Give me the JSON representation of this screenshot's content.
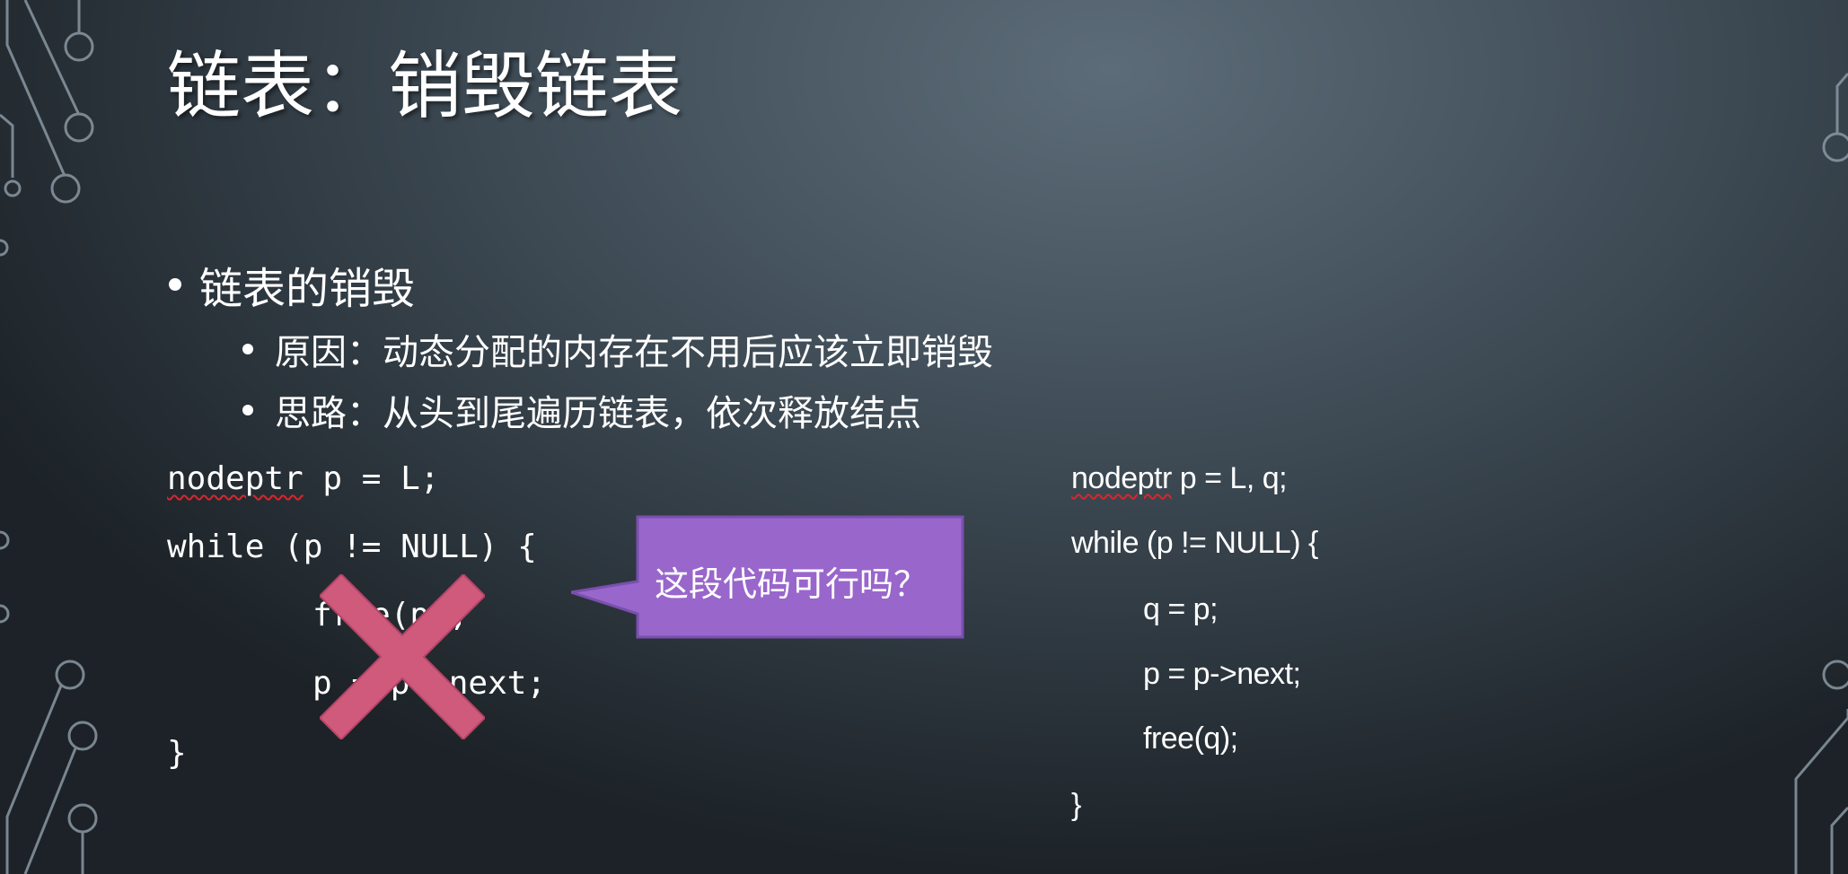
{
  "slide": {
    "title": "链表：销毁链表",
    "bullet_main": "链表的销毁",
    "sub_bullets": [
      "原因：动态分配的内存在不用后应该立即销毁",
      "思路：从头到尾遍历链表，依次释放结点"
    ]
  },
  "code_left": {
    "line1_keyword": "nodeptr",
    "line1_rest": " p = L;",
    "line2": "while (p != NULL) {",
    "line3": "free(p);",
    "line4": "p = p->next;",
    "line5": "}"
  },
  "code_right": {
    "line1_keyword": "nodeptr",
    "line1_rest": " p = L, q;",
    "line2": "while (p != NULL) {",
    "line3": "q = p;",
    "line4": "p = p->next;",
    "line5": "free(q);",
    "line6": "}"
  },
  "callout": {
    "text": "这段代码可行吗？",
    "fill": "#9966cc",
    "border": "#7a4fae"
  },
  "cross_mark": {
    "icon": "x-cross-icon",
    "color": "#d05a7c"
  },
  "colors": {
    "text": "#ffffff",
    "spellcheck": "#d8262b"
  }
}
